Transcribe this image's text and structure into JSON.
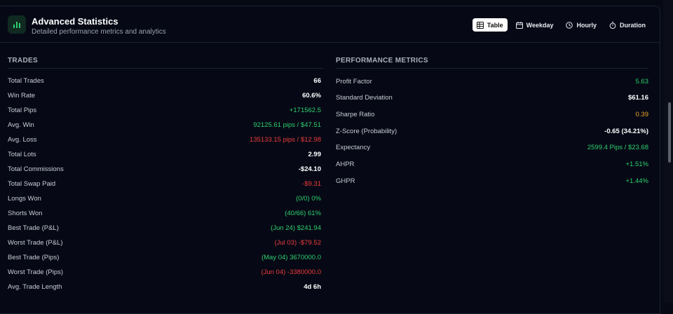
{
  "header": {
    "title": "Advanced Statistics",
    "subtitle": "Detailed performance metrics and analytics",
    "logo_icon": "bar-chart-icon",
    "tabs": [
      {
        "label": "Table",
        "icon": "table-icon",
        "active": true
      },
      {
        "label": "Weekday",
        "icon": "calendar-icon",
        "active": false
      },
      {
        "label": "Hourly",
        "icon": "clock-icon",
        "active": false
      },
      {
        "label": "Duration",
        "icon": "stopwatch-icon",
        "active": false
      }
    ]
  },
  "colors": {
    "accent_green": "#2ed06e",
    "negative_red": "#ee3b3b",
    "warning_orange": "#f0a22a",
    "background": "#060915"
  },
  "trades": {
    "title": "TRADES",
    "rows": [
      {
        "label": "Total Trades",
        "value": "66",
        "tone": "white"
      },
      {
        "label": "Win Rate",
        "value": "60.6%",
        "tone": "white"
      },
      {
        "label": "Total Pips",
        "value": "+171562.5",
        "tone": "green"
      },
      {
        "label": "Avg. Win",
        "value": "92125.61 pips / $47.51",
        "tone": "green"
      },
      {
        "label": "Avg. Loss",
        "value": "135133.15 pips / $12.98",
        "tone": "red"
      },
      {
        "label": "Total Lots",
        "value": "2.99",
        "tone": "white"
      },
      {
        "label": "Total Commissions",
        "value": "-$24.10",
        "tone": "white"
      },
      {
        "label": "Total Swap Paid",
        "value": "-$9.31",
        "tone": "red"
      },
      {
        "label": "Longs Won",
        "value": "(0/0) 0%",
        "tone": "green"
      },
      {
        "label": "Shorts Won",
        "value": "(40/66) 61%",
        "tone": "green"
      },
      {
        "label": "Best Trade (P&L)",
        "value": "(Jun 24) $241.94",
        "tone": "green"
      },
      {
        "label": "Worst Trade (P&L)",
        "value": "(Jul 03) -$79.52",
        "tone": "red"
      },
      {
        "label": "Best Trade (Pips)",
        "value": "(May 04) 3670000.0",
        "tone": "green"
      },
      {
        "label": "Worst Trade (Pips)",
        "value": "(Jun 04) -3380000.0",
        "tone": "red"
      },
      {
        "label": "Avg. Trade Length",
        "value": "4d 6h",
        "tone": "white"
      }
    ]
  },
  "performance": {
    "title": "PERFORMANCE METRICS",
    "rows": [
      {
        "label": "Profit Factor",
        "value": "5.63",
        "tone": "green"
      },
      {
        "label": "Standard Deviation",
        "value": "$61.16",
        "tone": "white"
      },
      {
        "label": "Sharpe Ratio",
        "value": "0.39",
        "tone": "orange"
      },
      {
        "label": "Z-Score (Probability)",
        "value": "-0.65 (34.21%)",
        "tone": "white"
      },
      {
        "label": "Expectancy",
        "value": "2599.4 Pips / $23.68",
        "tone": "green"
      },
      {
        "label": "AHPR",
        "value": "+1.51%",
        "tone": "green"
      },
      {
        "label": "GHPR",
        "value": "+1.44%",
        "tone": "green"
      }
    ]
  }
}
